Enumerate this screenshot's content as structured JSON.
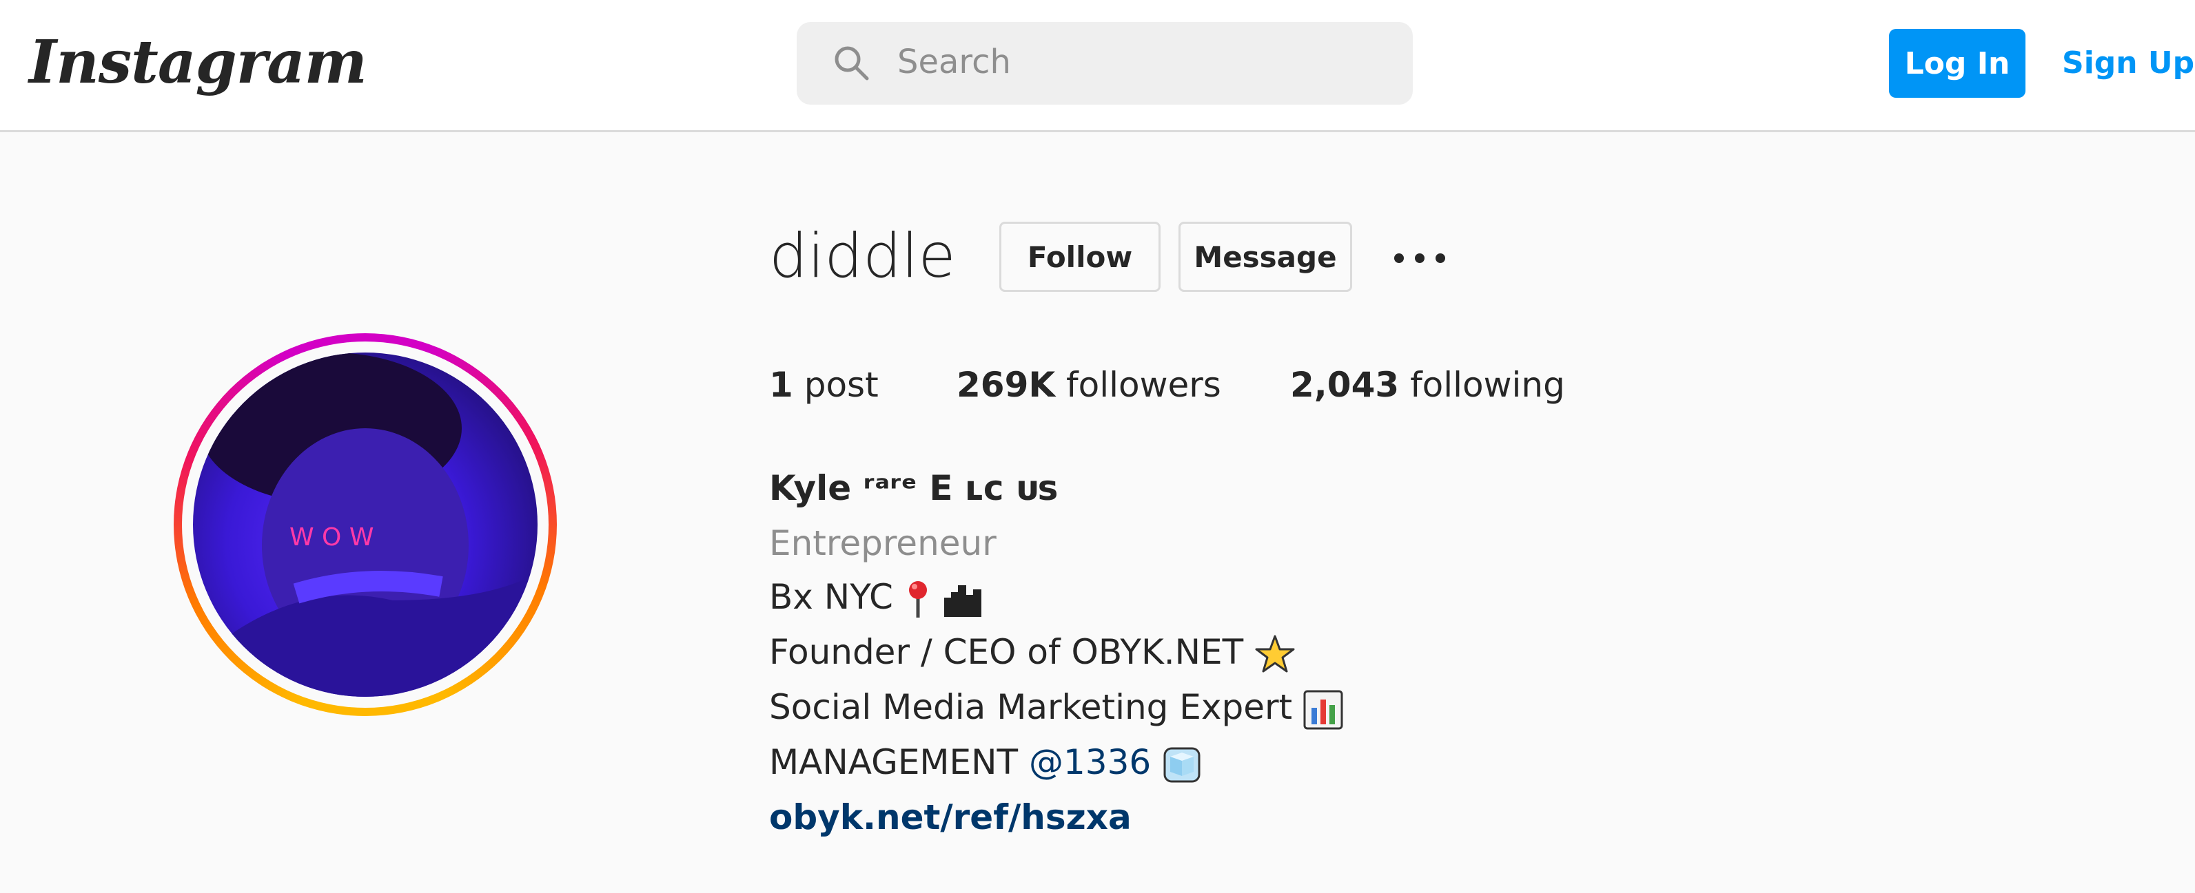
{
  "header": {
    "logo_text": "Instagram",
    "search_placeholder": "Search",
    "login_label": "Log In",
    "signup_label": "Sign Up"
  },
  "profile": {
    "username": "diddle",
    "follow_label": "Follow",
    "message_label": "Message",
    "stats": {
      "posts_count": "1",
      "posts_label": "post",
      "followers_count": "269K",
      "followers_label": "followers",
      "following_count": "2,043",
      "following_label": "following"
    },
    "bio": {
      "full_name": "Kyle ʳᵃʳᵉ E ʟᴄ ᴜs",
      "category": "Entrepreneur",
      "line1": "Bx NYC",
      "line2": "Founder / CEO of OBYK.NET",
      "line3": "Social Media Marketing Expert",
      "line4_prefix": "MANAGEMENT",
      "line4_mention": "@1336",
      "website": "obyk.net/ref/hszxa"
    },
    "avatar_text": "W O W"
  },
  "colors": {
    "accent": "#0095f6",
    "link": "#00376b",
    "muted": "#8e8e8e",
    "text": "#262626"
  }
}
